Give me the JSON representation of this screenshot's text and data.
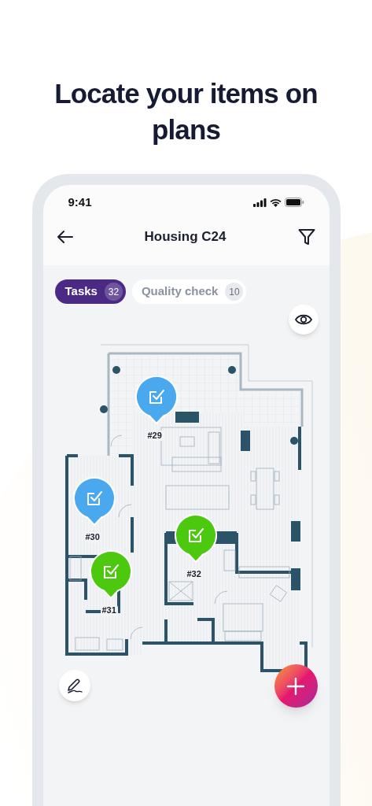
{
  "headline": "Locate your items on plans",
  "status_bar": {
    "time": "9:41"
  },
  "header": {
    "title": "Housing C24"
  },
  "tabs": [
    {
      "label": "Tasks",
      "count": "32",
      "selected": true
    },
    {
      "label": "Quality check",
      "count": "10",
      "selected": false
    }
  ],
  "plan": {
    "pins": [
      {
        "label": "#29",
        "color": "#4aa8ee"
      },
      {
        "label": "#30",
        "color": "#4aa8ee"
      },
      {
        "label": "#31",
        "color": "#4cc80f"
      },
      {
        "label": "#32",
        "color": "#4cc80f"
      }
    ]
  }
}
